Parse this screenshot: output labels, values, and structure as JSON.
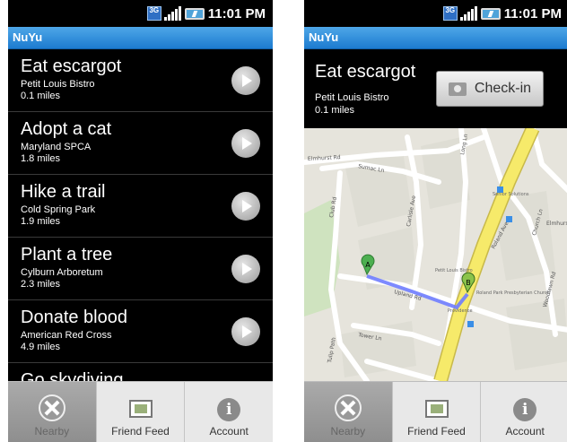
{
  "status": {
    "network": "3G",
    "time": "11:01 PM"
  },
  "app": {
    "title": "NuYu"
  },
  "list": [
    {
      "title": "Eat escargot",
      "place": "Petit Louis Bistro",
      "distance": "0.1 miles"
    },
    {
      "title": "Adopt a cat",
      "place": "Maryland SPCA",
      "distance": "1.8 miles"
    },
    {
      "title": "Hike a trail",
      "place": "Cold Spring Park",
      "distance": "1.9 miles"
    },
    {
      "title": "Plant a tree",
      "place": "Cylburn Arboretum",
      "distance": "2.3 miles"
    },
    {
      "title": "Donate blood",
      "place": "American Red Cross",
      "distance": "4.9 miles"
    },
    {
      "title": "Go skydiving"
    }
  ],
  "tabs": [
    {
      "label": "Nearby",
      "icon": "compass-icon",
      "active": true
    },
    {
      "label": "Friend Feed",
      "icon": "picture-icon",
      "active": false
    },
    {
      "label": "Account",
      "icon": "info-icon",
      "active": false
    }
  ],
  "detail": {
    "title": "Eat escargot",
    "place": "Petit Louis Bistro",
    "distance": "0.1 miles",
    "checkin_label": "Check-in"
  },
  "map": {
    "streets": [
      "Elmhurst Rd",
      "Sumac Ln",
      "Club Rd",
      "Carlisle Ave",
      "Long Ln",
      "Roland Ave",
      "Upland Rd",
      "Tower Ln",
      "Tulip Path",
      "Church Ln",
      "Woodlawn Rd",
      "Elmhurst"
    ],
    "places": [
      "Petit Louis Bistro",
      "Roland Park Presbyterian Church",
      "Senior Solutions",
      "Providence"
    ],
    "markers": [
      "A",
      "B"
    ],
    "colors": {
      "route": "#6f7dff",
      "highway": "#f6ea6a",
      "park": "#cfe3bf",
      "block": "#e0dfd6"
    }
  },
  "colors": {
    "titlebar": "#2f8fde",
    "active_tab": "#9a9a9a"
  }
}
